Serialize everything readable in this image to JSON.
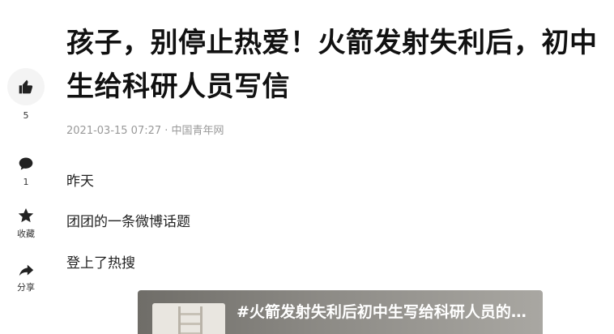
{
  "sidebar": {
    "like": {
      "icon": "thumbs-up-icon",
      "count": "5"
    },
    "comment": {
      "icon": "comment-icon",
      "count": "1"
    },
    "favorite": {
      "icon": "star-icon",
      "label": "收藏"
    },
    "share": {
      "icon": "share-icon",
      "label": "分享"
    }
  },
  "article": {
    "title": "孩子，别停止热爱！火箭发射失利后，初中生给科研人员写信",
    "meta": "2021-03-15 07:27 · 中国青年网",
    "paragraphs": [
      "昨天",
      "团团的一条微博话题",
      "登上了热搜"
    ]
  },
  "embed": {
    "title": "#火箭发射失利后初中生写给科研人员的信#"
  },
  "colors": {
    "title": "#111111",
    "meta": "#999999",
    "icon": "#222222",
    "like_bg": "#f4f4f4"
  }
}
